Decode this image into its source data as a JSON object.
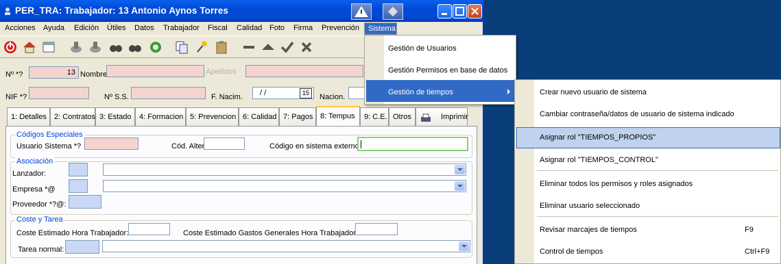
{
  "window": {
    "title": "PER_TRA: Trabajador: 13 Antonio Aynos Torres"
  },
  "menubar": [
    "Acciones",
    "Ayuda",
    "Edición",
    "Útiles",
    "Datos",
    "Trabajador",
    "Fiscal",
    "Calidad",
    "Foto",
    "Firma",
    "Prevención",
    "Sistema"
  ],
  "toolbar_icons": [
    "power-icon",
    "home-icon",
    "windows-icon",
    "stamp-check-icon",
    "stamp-check-2-icon",
    "binoculars-icon",
    "binoculars-2-icon",
    "refresh-icon",
    "copy-icon",
    "pin-icon",
    "paste-icon",
    "minus-icon",
    "triangle-up-icon",
    "check-icon",
    "x-icon"
  ],
  "form": {
    "numero_label": "Nº *?",
    "numero_value": "13",
    "nombre_label": "Nombre",
    "apellidos_label": "Apellidos",
    "nif_label": "NIF *?",
    "nss_label": "Nº S.S.",
    "fnacim_label": "F. Nacim.",
    "fnacim_value": "/ /",
    "fnacim_btn": "15",
    "nacion_label": "Nacion."
  },
  "tabs": [
    "1: Detalles",
    "2: Contratos",
    "3: Estado",
    "4: Formacion",
    "5: Prevencion",
    "6: Calidad",
    "7: Pagos",
    "8: Tempus",
    "9: C.E.",
    "Otros",
    "Imprimir"
  ],
  "active_tab": "8: Tempus",
  "tempus": {
    "codigos_title": "Códigos Especiales",
    "usuario_sistema_label": "Usuario Sistema *?",
    "cod_alternativo_label": "Cód. Alternativo",
    "codigo_externo_label": "Código en sistema externo",
    "asociacion_title": "Asociación",
    "lanzador_label": "Lanzador:",
    "empresa_label": "Empresa *@",
    "proveedor_label": "Proveedor *?@:",
    "coste_title": "Coste y Tarea",
    "coste_hora_label": "Coste Estimado Hora Trabajador:",
    "coste_gastos_label": "Coste Estimado Gastos Generales Hora Trabajador:",
    "tarea_label": "Tarea normal:"
  },
  "sistema_menu": {
    "items": [
      "Gestión de Usuarios",
      "Gestión Permisos en base de datos",
      "Gestión de tiempos"
    ],
    "highlighted": "Gestión de tiempos"
  },
  "tiempos_submenu": {
    "items": [
      {
        "label": "Crear nuevo usuario de sistema",
        "shortcut": ""
      },
      {
        "label": "Cambiar contraseña/datos de usuario de sistema indicado",
        "shortcut": ""
      },
      {
        "label": "Asignar rol \"TIEMPOS_PROPIOS\"",
        "shortcut": ""
      },
      {
        "label": "Asignar rol \"TIEMPOS_CONTROL\"",
        "shortcut": ""
      },
      {
        "label": "Eliminar todos los permisos y roles asignados",
        "shortcut": ""
      },
      {
        "label": "Eliminar usuario seleccionado",
        "shortcut": ""
      },
      {
        "label": "Revisar marcajes de tiempos",
        "shortcut": "F9"
      },
      {
        "label": "Control de tiempos",
        "shortcut": "Ctrl+F9"
      }
    ],
    "highlighted": "Asignar rol \"TIEMPOS_PROPIOS\""
  },
  "colors": {
    "titlebar": "#0049d4",
    "desktop": "#0a3e7a",
    "required_field": "#f5d4d0",
    "lookup_field": "#c9d8f5",
    "highlight": "#c1d2ee"
  }
}
